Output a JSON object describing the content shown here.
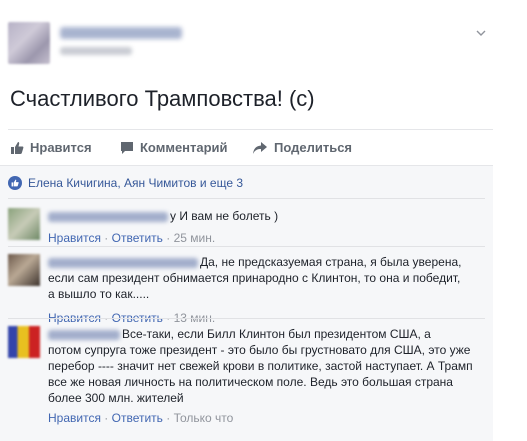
{
  "post": {
    "text": "Счастливого Трамповства! (с)"
  },
  "actions": {
    "like": "Нравится",
    "comment": "Комментарий",
    "share": "Поделиться"
  },
  "likes_line": "Елена Кичигина, Аян Чимитов и еще 3",
  "comments": [
    {
      "text": "y И вам не болеть )",
      "like": "Нравится",
      "reply": "Ответить",
      "time": "25 мин."
    },
    {
      "text_lines": [
        "Да, не предсказуемая страна, я была уверена,",
        "если сам президент обнимается принародно с Клинтон, то она и победит,",
        "а вышло то как....."
      ],
      "like": "Нравится",
      "reply": "Ответить",
      "time": "13 мин."
    },
    {
      "text_lines": [
        "Все-таки, если Билл Клинтон был президентом США, а",
        "потом супруга тоже президент - это было бы грустновато для США, это уже",
        "перебор ---- значит нет свежей крови в политике, застой наступает. А Трамп",
        "все же новая личность на политическом поле. Ведь это большая страна",
        "более 300 млн. жителей"
      ],
      "like": "Нравится",
      "reply": "Ответить",
      "time": "Только что"
    }
  ],
  "colors": {
    "link": "#4267b2",
    "muted": "#90949c",
    "action": "#606770"
  }
}
